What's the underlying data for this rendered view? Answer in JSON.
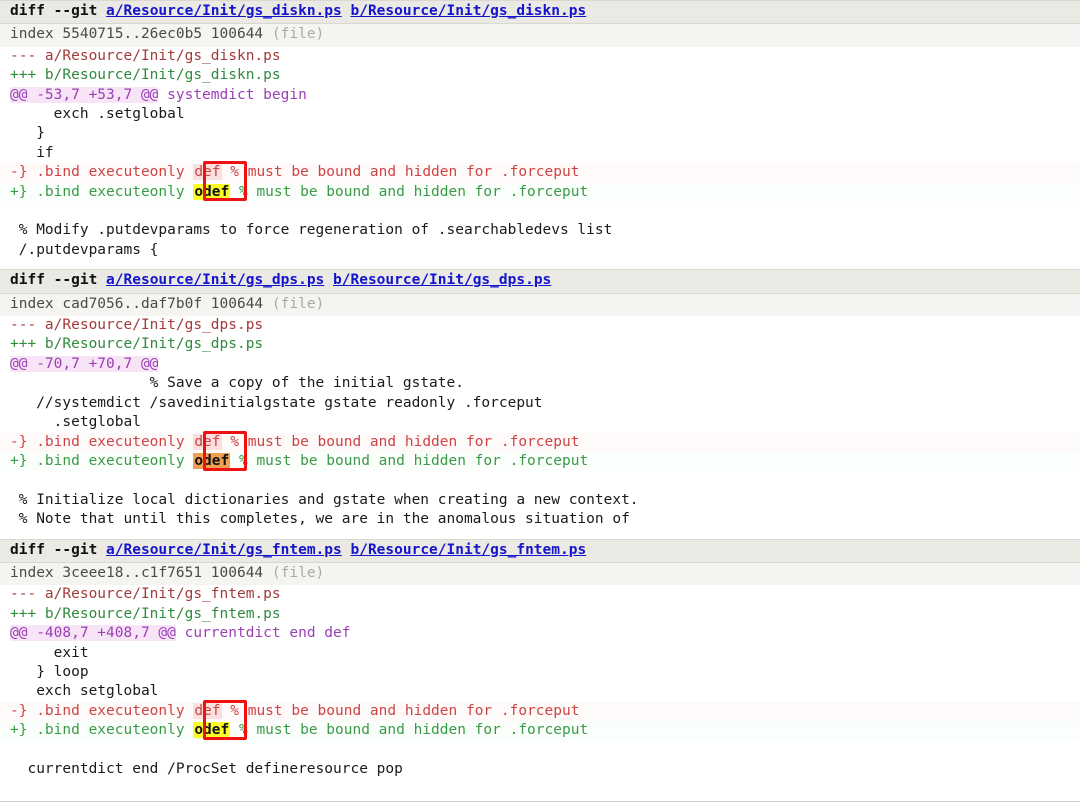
{
  "view": {
    "type": "git-diff",
    "colors": {
      "link": "#1414cc",
      "added": "#3a9a48",
      "removed": "#cc4444",
      "hunk": "#9b3fb5",
      "header_bg": "#eae9e4",
      "index_bg": "#f5f4f0",
      "highlight_yellow": "#fbfb28",
      "highlight_orange": "#f0a051",
      "annotation_box": "#ee1111"
    }
  },
  "files": [
    {
      "header": {
        "command": "diff --git",
        "path_a": "a/Resource/Init/gs_diskn.ps",
        "path_b": "b/Resource/Init/gs_diskn.ps"
      },
      "index": {
        "text": "index 5540715..26ec0b5 100644",
        "note": "(file)"
      },
      "minus_file": "--- a/Resource/Init/gs_diskn.ps",
      "plus_file": "+++ b/Resource/Init/gs_diskn.ps",
      "hunk": {
        "range": "@@ -53,7 +53,7 @@",
        "context": " systemdict begin"
      },
      "context_before": [
        "     exch .setglobal",
        "   }",
        "   if"
      ],
      "removed_line": {
        "prefix": "-} .bind executeonly ",
        "word": "def",
        "suffix": " % must be bound and hidden for .forceput"
      },
      "added_line": {
        "prefix": "+} .bind executeonly ",
        "word": "odef",
        "highlight": "yellow",
        "suffix": " % must be bound and hidden for .forceput"
      },
      "context_after": [
        "",
        " % Modify .putdevparams to force regeneration of .searchabledevs list",
        " /.putdevparams {"
      ]
    },
    {
      "header": {
        "command": "diff --git",
        "path_a": "a/Resource/Init/gs_dps.ps",
        "path_b": "b/Resource/Init/gs_dps.ps"
      },
      "index": {
        "text": "index cad7056..daf7b0f 100644",
        "note": "(file)"
      },
      "minus_file": "--- a/Resource/Init/gs_dps.ps",
      "plus_file": "+++ b/Resource/Init/gs_dps.ps",
      "hunk": {
        "range": "@@ -70,7 +70,7 @@",
        "context": ""
      },
      "context_before": [
        "                % Save a copy of the initial gstate.",
        "   //systemdict /savedinitialgstate gstate readonly .forceput",
        "     .setglobal"
      ],
      "removed_line": {
        "prefix": "-} .bind executeonly ",
        "word": "def",
        "suffix": " % must be bound and hidden for .forceput"
      },
      "added_line": {
        "prefix": "+} .bind executeonly ",
        "word": "odef",
        "highlight": "orange",
        "suffix": " % must be bound and hidden for .forceput"
      },
      "context_after": [
        "",
        " % Initialize local dictionaries and gstate when creating a new context.",
        " % Note that until this completes, we are in the anomalous situation of"
      ]
    },
    {
      "header": {
        "command": "diff --git",
        "path_a": "a/Resource/Init/gs_fntem.ps",
        "path_b": "b/Resource/Init/gs_fntem.ps"
      },
      "index": {
        "text": "index 3ceee18..c1f7651 100644",
        "note": "(file)"
      },
      "minus_file": "--- a/Resource/Init/gs_fntem.ps",
      "plus_file": "+++ b/Resource/Init/gs_fntem.ps",
      "hunk": {
        "range": "@@ -408,7 +408,7 @@",
        "context": " currentdict end def"
      },
      "context_before": [
        "     exit",
        "   } loop",
        "   exch setglobal"
      ],
      "removed_line": {
        "prefix": "-} .bind executeonly ",
        "word": "def",
        "suffix": " % must be bound and hidden for .forceput"
      },
      "added_line": {
        "prefix": "+} .bind executeonly ",
        "word": "odef",
        "highlight": "yellow",
        "suffix": " % must be bound and hidden for .forceput"
      },
      "context_after": [
        "",
        "  currentdict end /ProcSet defineresource pop"
      ]
    }
  ]
}
